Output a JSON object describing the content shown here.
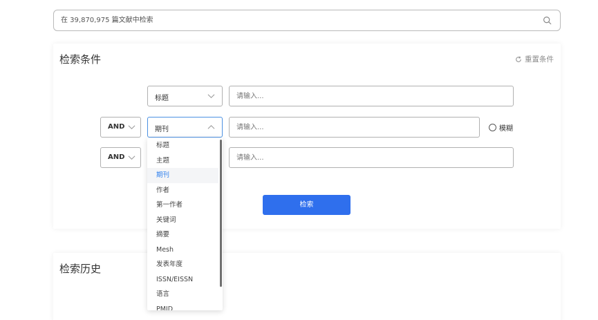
{
  "top_search": {
    "placeholder": "在 39,870,975 篇文献中检索",
    "icon": "search-icon"
  },
  "criteria": {
    "title": "检索条件",
    "reset_label": "重置条件",
    "rows": [
      {
        "field": "标题",
        "placeholder": "请输入..."
      },
      {
        "operator": "AND",
        "field": "期刊",
        "placeholder": "请输入...",
        "fuzzy_label": "模糊"
      },
      {
        "operator": "AND",
        "placeholder": "请输入..."
      }
    ],
    "search_button": "检索"
  },
  "dropdown": {
    "items": [
      "标题",
      "主题",
      "期刊",
      "作者",
      "第一作者",
      "关键词",
      "摘要",
      "Mesh",
      "发表年度",
      "ISSN/EISSN",
      "语言",
      "PMID"
    ],
    "selected": "期刊"
  },
  "history": {
    "title": "检索历史"
  },
  "colors": {
    "primary": "#2f6fed",
    "selected_text": "#2f80ed",
    "border": "#b0b0b0"
  }
}
